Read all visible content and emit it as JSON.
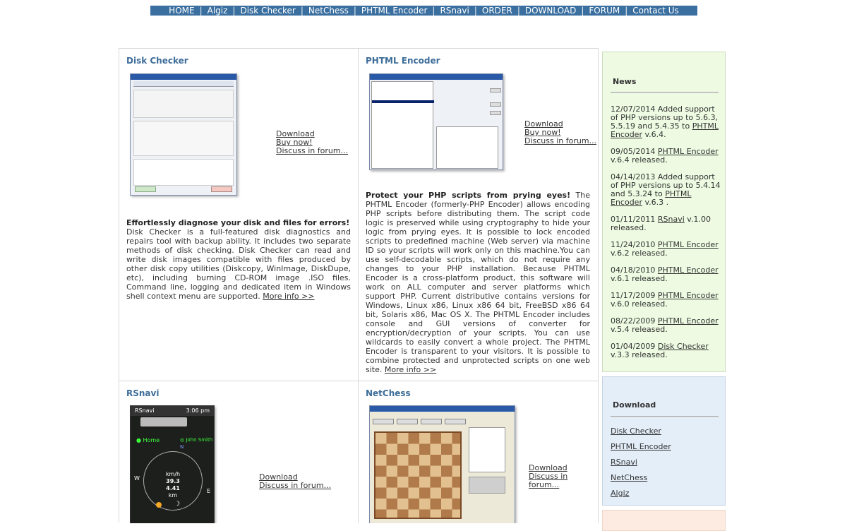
{
  "nav": [
    "HOME",
    "Algiz",
    "Disk Checker",
    "NetChess",
    "PHTML Encoder",
    "RSnavi",
    "ORDER",
    "DOWNLOAD",
    "FORUM",
    "Contact Us"
  ],
  "products": {
    "disk_checker": {
      "title": "Disk Checker",
      "links": [
        "Download",
        "Buy now!",
        "Discuss in forum..."
      ],
      "lead": "Effortlessly diagnose your disk and files for errors!",
      "body": "Disk Checker is a full-featured disk diagnostics and repairs tool with backup ability. It includes two separate methods of disk checking. Disk Checker can read and write disk images compatible with files produced by other disk copy utilities (Diskcopy, WinImage, DiskDupe, etc), including burning CD-ROM image .ISO files. Command line, logging and dedicated item in Windows shell context menu are supported.",
      "more": "More info >>"
    },
    "phtml_encoder": {
      "title": "PHTML Encoder",
      "links": [
        "Download",
        "Buy now!",
        "Discuss in forum..."
      ],
      "lead": "Protect your PHP scripts from prying eyes!",
      "body": "The PHTML Encoder (formerly-PHP Encoder) allows encoding PHP scripts before distributing them. The script code logic is preserved while using cryptography to hide your logic from prying eyes. It is possible to lock encoded scripts to predefined machine (Web server) via machine ID so your scripts will work only on this machine.You can use self-decodable scripts, which do not require any changes to your PHP installation. Because PHTML Encoder is a cross-platform product, this software will work on ALL computer and server platforms which support PHP. Current distributive contains versions for Windows, Linux x86, Linux x86 64 bit, FreeBSD x86 64 bit, Solaris x86, Mac OS X. The PHTML Encoder includes console and GUI versions of converter for encryption/decryption of your scripts. You can use wildcards to easily convert a whole project. The PHTML Encoder is transparent to your visitors. It is possible to combine protected and unprotected scripts on one web site.",
      "more": "More info >>"
    },
    "rsnavi": {
      "title": "RSnavi",
      "links": [
        "Download",
        "Discuss in forum..."
      ],
      "screen": {
        "app": "RSnavi",
        "time": "3:06 pm",
        "home": "Home",
        "contact": "John Smith",
        "speed_unit": "km/h",
        "speed": "39.3",
        "dist": "4.41",
        "dist_unit": "km",
        "west": "W",
        "east": "E",
        "north": "N"
      }
    },
    "netchess": {
      "title": "NetChess",
      "links": [
        "Download",
        "Discuss in forum..."
      ]
    }
  },
  "news": {
    "heading": "News",
    "items": [
      {
        "pre": "12/07/2014 Added support of PHP versions up to 5.6.3, 5.5.19 and 5.4.35 to ",
        "link": "PHTML Encoder",
        "post": " v.6.4."
      },
      {
        "pre": "09/05/2014 ",
        "link": "PHTML Encoder",
        "post": " v.6.4 released."
      },
      {
        "pre": "04/14/2013 Added support of PHP versions up to 5.4.14 and 5.3.24 to ",
        "link": "PHTML Encoder",
        "post": " v.6.3 ."
      },
      {
        "pre": "01/11/2011 ",
        "link": "RSnavi",
        "post": " v.1.00 released."
      },
      {
        "pre": "11/24/2010 ",
        "link": "PHTML Encoder",
        "post": " v.6.2 released."
      },
      {
        "pre": "04/18/2010 ",
        "link": "PHTML Encoder",
        "post": " v.6.1 released."
      },
      {
        "pre": "11/17/2009 ",
        "link": "PHTML Encoder",
        "post": " v.6.0 released."
      },
      {
        "pre": "08/22/2009 ",
        "link": "PHTML Encoder",
        "post": " v.5.4 released."
      },
      {
        "pre": "01/04/2009 ",
        "link": "Disk Checker",
        "post": " v.3.3 released."
      }
    ]
  },
  "download": {
    "heading": "Download",
    "items": [
      "Disk Checker",
      "PHTML Encoder",
      "RSnavi",
      "NetChess",
      "Algiz"
    ]
  }
}
